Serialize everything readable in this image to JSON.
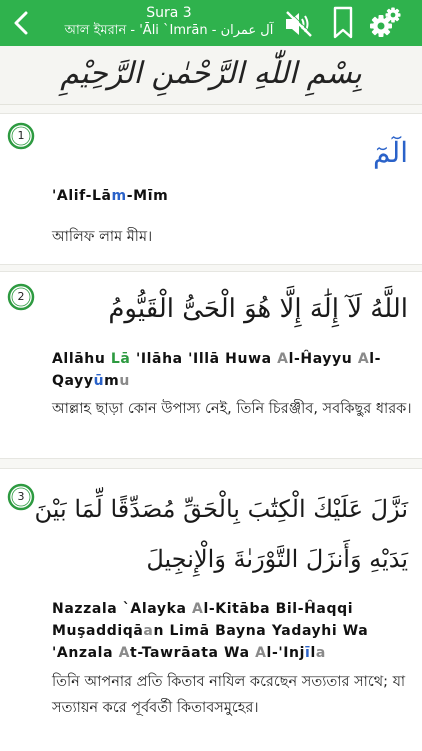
{
  "header": {
    "sura_label": "Sura 3",
    "subtitle": "আল ইমরান - 'Āli `Imrān - آل عمران"
  },
  "bismillah": {
    "text": "بِسْمِ اللّٰهِ الرَّحْمٰنِ الرَّحِيْمِ"
  },
  "colors": {
    "header_green": "#2fb24d",
    "accent_blue": "#2a62c9",
    "silent_gray": "#8a8a8a"
  },
  "verses": [
    {
      "number": "1",
      "arabic": "الٓمٓ",
      "translit_parts": [
        "'Alif-Lā",
        "m",
        "-Mīm"
      ],
      "translation": "আলিফ লাম মীম।"
    },
    {
      "number": "2",
      "arabic": "اللَّهُ لَآ إِلَٰهَ إِلَّا هُوَ الْحَىُّ الْقَيُّومُ",
      "translit_parts": [
        "Allāhu ",
        "Lā",
        " 'Ilāha 'Illā Huwa ",
        "A",
        "l-Ĥayyu ",
        "A",
        "l-Qayy",
        "ū",
        "m",
        "u"
      ],
      "translation": "আল্লাহ ছাড়া কোন উপাস্য নেই, তিনি চিরঞ্জীব, সবকিছুর ধারক।"
    },
    {
      "number": "3",
      "arabic_line1": "نَزَّلَ عَلَيْكَ الْكِتَٰبَ بِالْحَقِّ مُصَدِّقًا لِّمَا بَيْنَ",
      "arabic_line2": "يَدَيْهِ وَأَنزَلَ التَّوْرَىٰةَ وَالْإِنجِيلَ",
      "translit_parts": [
        "Nazzala `Alayka ",
        "A",
        "l-Kitāba Bil-Ĥaqqi Muşaddiqā",
        "a",
        "n Limā Bayna Yadayhi Wa 'Anzala ",
        "A",
        "t-Tawrāata Wa ",
        "A",
        "l-'Inj",
        "ī",
        "l",
        "a"
      ],
      "translation": "তিনি আপনার প্রতি কিতাব নাযিল করেছেন সত্যতার সাথে; যা সত্যায়ন করে পূর্ববর্তী কিতাবসমুহের।"
    }
  ]
}
